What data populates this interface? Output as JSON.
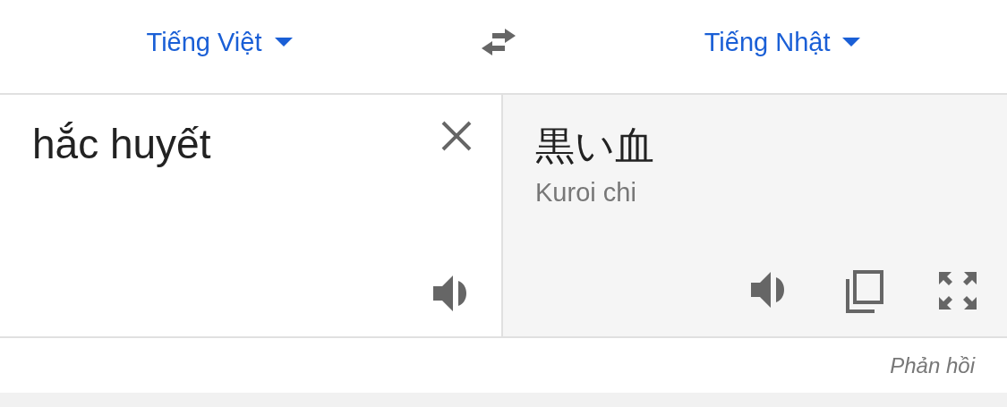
{
  "languages": {
    "source": "Tiếng Việt",
    "target": "Tiếng Nhật"
  },
  "source": {
    "text": "hắc huyết"
  },
  "result": {
    "text": "黒い血",
    "romanization": "Kuroi chi"
  },
  "feedback_link": "Phản hồi"
}
